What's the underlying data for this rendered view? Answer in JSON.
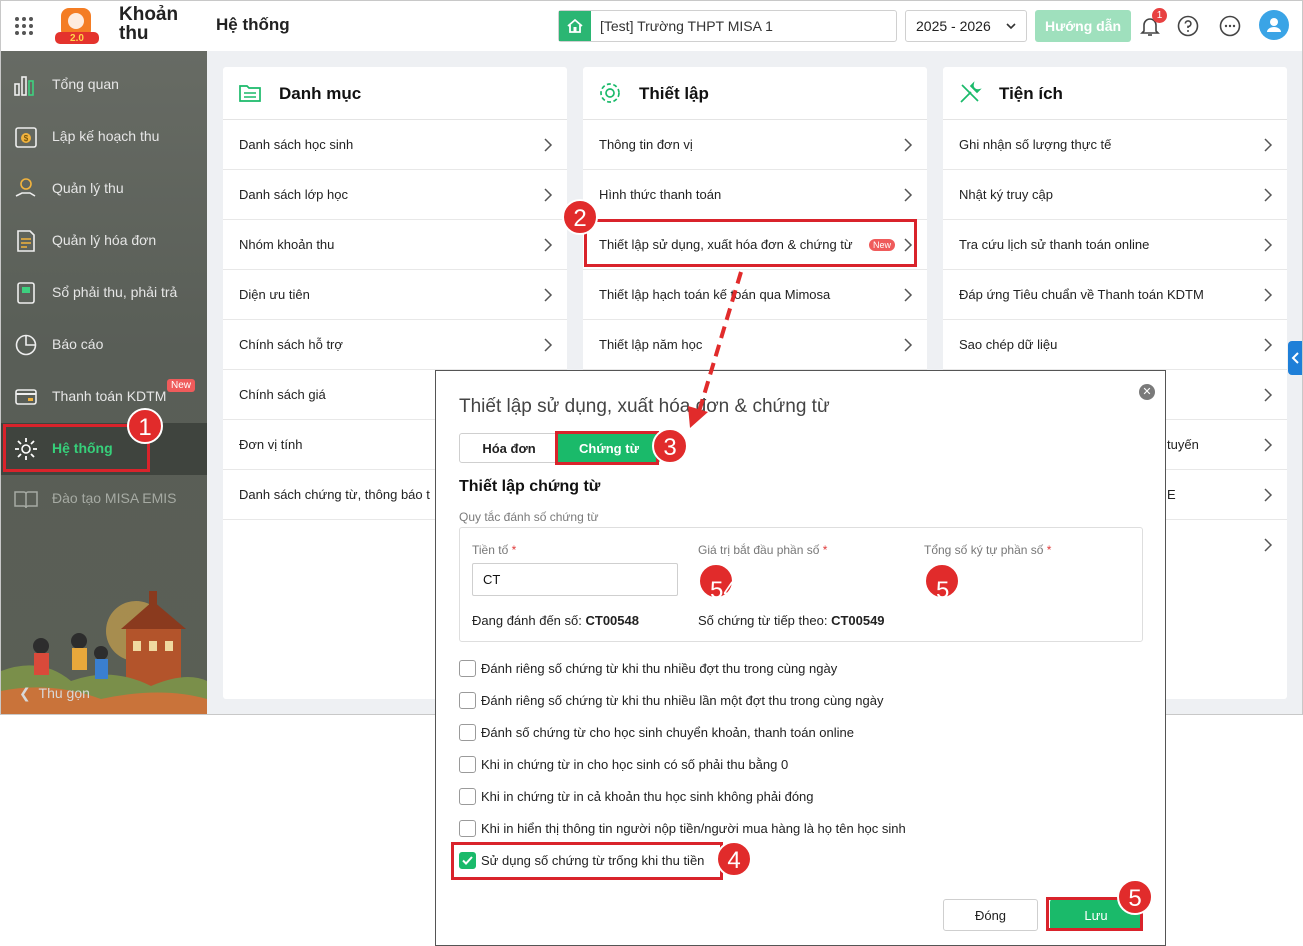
{
  "topbar": {
    "logo_badge": "2.0",
    "app_name": "Khoản thu",
    "page_title": "Hệ thống",
    "school": "[Test] Trường THPT MISA 1",
    "year": "2025 - 2026",
    "guide_button": "Hướng dẫn",
    "notification_count": "1"
  },
  "sidebar": {
    "items": [
      {
        "label": "Tổng quan",
        "icon": "chart-bars-icon"
      },
      {
        "label": "Lập kế hoạch thu",
        "icon": "plan-money-icon"
      },
      {
        "label": "Quản lý thu",
        "icon": "hand-money-icon"
      },
      {
        "label": "Quản lý hóa đơn",
        "icon": "invoice-icon"
      },
      {
        "label": "Sổ phải thu, phải trả",
        "icon": "ledger-icon"
      },
      {
        "label": "Báo cáo",
        "icon": "pie-chart-icon"
      },
      {
        "label": "Thanh toán KDTM",
        "icon": "card-payment-icon",
        "tag": "New"
      },
      {
        "label": "Hệ thống",
        "icon": "gear-icon"
      },
      {
        "label": "Đào tạo MISA EMIS",
        "icon": "book-icon"
      }
    ],
    "collapse_label": "Thu gọn"
  },
  "cards": {
    "catalog": {
      "title": "Danh mục",
      "items": [
        "Danh sách học sinh",
        "Danh sách lớp học",
        "Nhóm khoản thu",
        "Diện ưu tiên",
        "Chính sách hỗ trợ",
        "Chính sách giá",
        "Đơn vị tính",
        "Danh sách chứng từ, thông báo t"
      ]
    },
    "settings": {
      "title": "Thiết lập",
      "items": [
        "Thông tin đơn vị",
        "Hình thức thanh toán",
        "Thiết lập sử dụng, xuất hóa đơn & chứng từ",
        "Thiết lập hạch toán kế toán qua Mimosa",
        "Thiết lập năm học"
      ],
      "new_tag": "New"
    },
    "utilities": {
      "title": "Tiện ích",
      "items": [
        "Ghi nhận số lượng thực tế",
        "Nhật ký truy cập",
        "Tra cứu lịch sử thanh toán online",
        "Đáp ứng Tiêu chuẩn về Thanh toán KDTM",
        "Sao chép dữ liệu"
      ],
      "partial": [
        "tuyến",
        "E"
      ]
    }
  },
  "dialog": {
    "title": "Thiết lập sử dụng, xuất hóa đơn & chứng từ",
    "tabs": {
      "invoice": "Hóa đơn",
      "voucher": "Chứng từ"
    },
    "section_title": "Thiết lập chứng từ",
    "group_label": "Quy tắc đánh số chứng từ",
    "fields": {
      "prefix": {
        "label": "Tiền tố",
        "value": "CT"
      },
      "start": {
        "label": "Giá trị bắt đầu phần số",
        "value": "549"
      },
      "digits": {
        "label": "Tổng số ký tự phần số",
        "value": "5"
      },
      "required_mark": "*"
    },
    "current": {
      "label": "Đang đánh đến số:",
      "value": "CT00548"
    },
    "next": {
      "label": "Số chứng từ tiếp theo:",
      "value": "CT00549"
    },
    "options": [
      {
        "label": "Đánh riêng số chứng từ khi thu nhiều đợt thu trong cùng ngày",
        "checked": false
      },
      {
        "label": "Đánh riêng số chứng từ khi thu nhiều lần một đợt thu trong cùng ngày",
        "checked": false
      },
      {
        "label": "Đánh số chứng từ cho học sinh chuyển khoản, thanh toán online",
        "checked": false
      },
      {
        "label": "Khi in chứng từ in cho học sinh có số phải thu bằng 0",
        "checked": false
      },
      {
        "label": "Khi in chứng từ in cả khoản thu học sinh không phải đóng",
        "checked": false
      },
      {
        "label": "Khi in hiển thị thông tin người nộp tiền/người mua hàng là họ tên học sinh",
        "checked": false
      },
      {
        "label": "Sử dụng số chứng từ trống khi thu tiền",
        "checked": true
      }
    ],
    "close_button": "Đóng",
    "save_button": "Lưu"
  },
  "steps": [
    "1",
    "2",
    "3",
    "4",
    "5"
  ],
  "colors": {
    "accent": "#1aba6a",
    "annotation": "#d9232b",
    "sidebar": "#5f635c"
  }
}
